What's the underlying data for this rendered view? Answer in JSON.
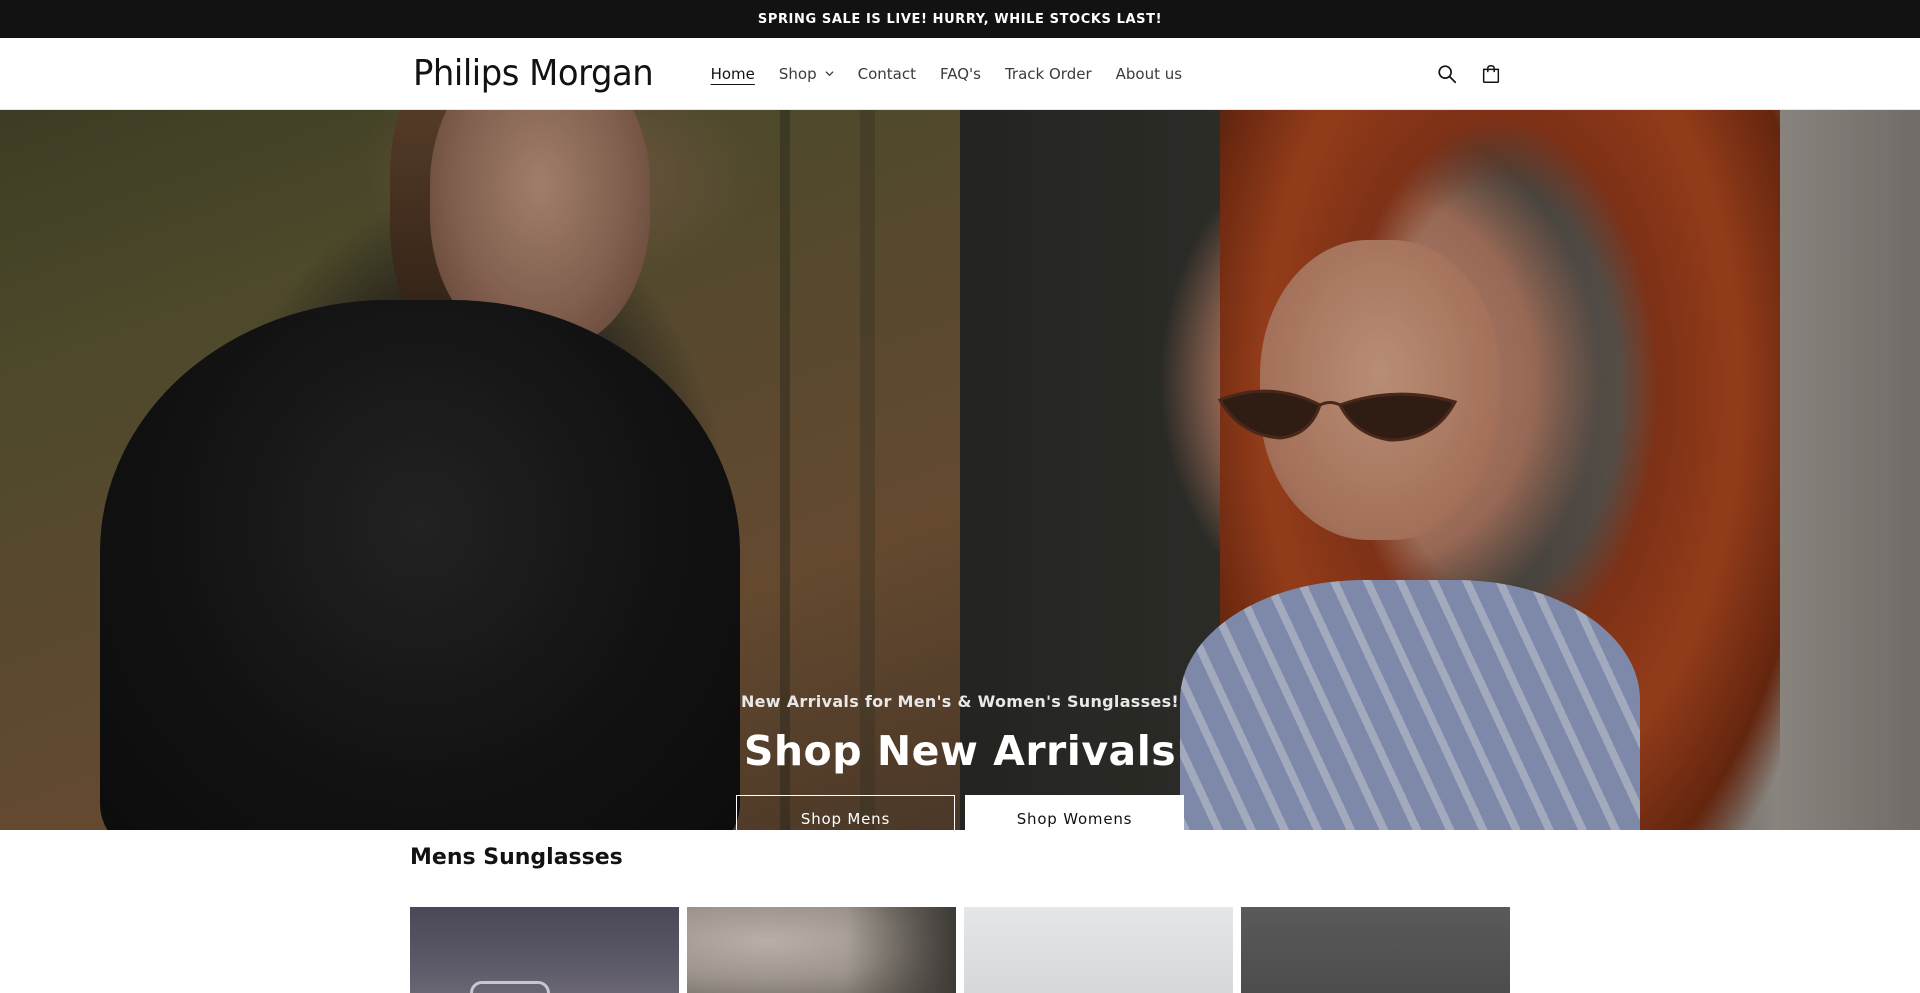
{
  "announcement": {
    "text": "SPRING SALE IS LIVE! HURRY, WHILE STOCKS LAST!"
  },
  "header": {
    "logo": "Philips Morgan",
    "nav": [
      {
        "label": "Home",
        "active": true
      },
      {
        "label": "Shop",
        "has_dropdown": true
      },
      {
        "label": "Contact"
      },
      {
        "label": "FAQ's"
      },
      {
        "label": "Track Order"
      },
      {
        "label": "About us"
      }
    ],
    "icons": [
      "search-icon",
      "cart-icon"
    ]
  },
  "hero": {
    "subheading": "New Arrivals for Men's & Women's Sunglasses!",
    "title": "Shop New Arrivals",
    "buttons": [
      {
        "label": "Shop Mens",
        "style": "outline"
      },
      {
        "label": "Shop Womens",
        "style": "solid"
      }
    ]
  },
  "section": {
    "title": "Mens Sunglasses",
    "products_visible": 4
  },
  "colors": {
    "announcement_bg": "#121212",
    "text": "#121212",
    "button_solid_bg": "#ffffff"
  }
}
